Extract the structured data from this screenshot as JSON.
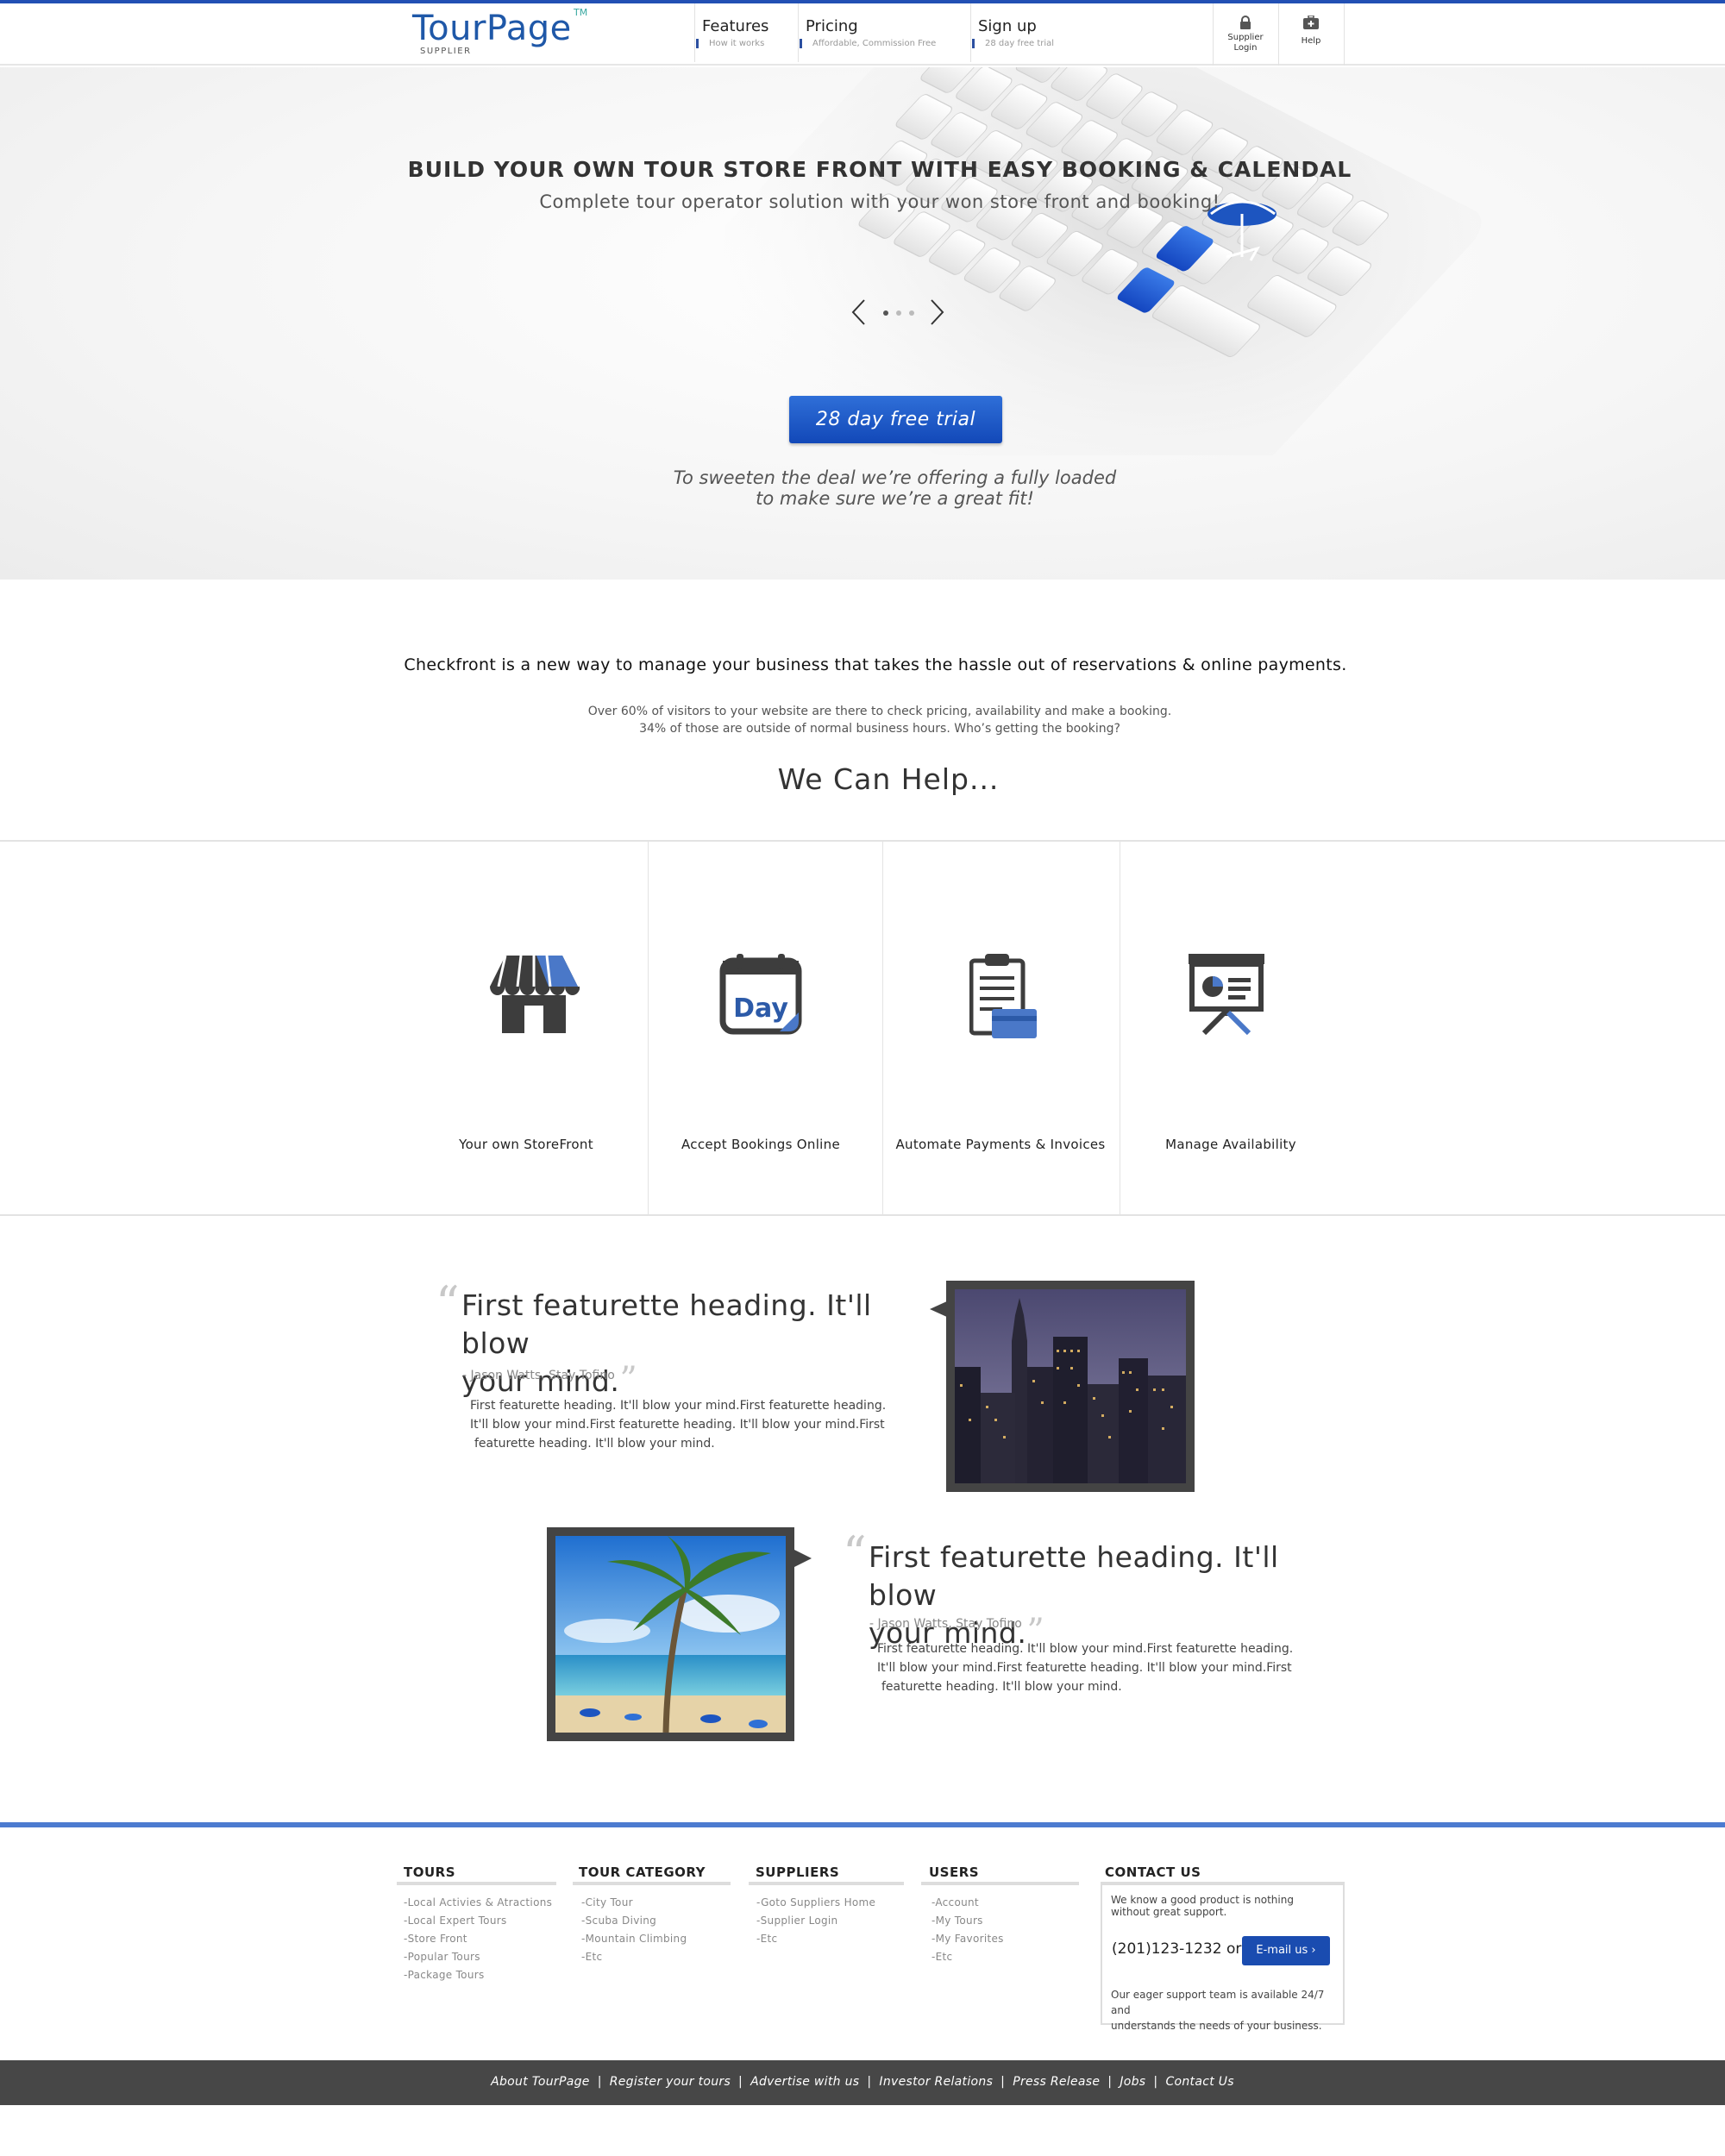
{
  "header": {
    "logo": "TourPage",
    "logo_tm": "TM",
    "logo_sub": "SUPPLIER",
    "nav": [
      {
        "title": "Features",
        "sub": "How it works"
      },
      {
        "title": "Pricing",
        "sub": "Affordable, Commission Free"
      },
      {
        "title": "Sign up",
        "sub": "28 day free trial"
      }
    ],
    "supplier_login": {
      "line1": "Supplier",
      "line2": "Login",
      "icon": "lock-icon"
    },
    "help": {
      "label": "Help",
      "icon": "first-aid-icon"
    }
  },
  "hero": {
    "title": "BUILD YOUR OWN TOUR STORE FRONT WITH EASY BOOKING & CALENDAL",
    "subtitle": "Complete tour operator solution with your won store front and booking!",
    "cta": "28 day free trial",
    "note_line1": "To sweeten the deal we’re offering a fully loaded",
    "note_line2": "to make sure we’re a great fit!"
  },
  "intro": {
    "lead": "Checkfront is a new way to manage your business that takes the hassle out of reservations & online payments.",
    "body_line1": "Over 60% of visitors to your website are there to check pricing, availability and make a booking.",
    "body_line2": "34% of those are outside of normal business hours. Who’s getting the booking?",
    "help_heading": "We Can Help..."
  },
  "features": [
    {
      "label": "Your own StoreFront",
      "icon": "storefront-icon"
    },
    {
      "label": "Accept Bookings Online",
      "icon": "calendar-day-icon",
      "icon_text": "Day"
    },
    {
      "label": "Automate Payments & Invoices",
      "icon": "clipboard-card-icon"
    },
    {
      "label": "Manage Availability",
      "icon": "presentation-board-icon"
    }
  ],
  "featurettes": [
    {
      "heading_line1": "First featurette heading. It'll blow",
      "heading_line2": "your mind.",
      "author": "- Jason Watts, Stay Tofino",
      "body_line1": "First featurette heading. It'll blow your mind.First featurette heading.",
      "body_line2": "It'll blow your mind.First featurette heading. It'll blow your mind.First",
      "body_line3": "featurette heading. It'll blow your mind.",
      "image": "city-skyline-night"
    },
    {
      "heading_line1": "First featurette heading. It'll blow",
      "heading_line2": "your mind.",
      "author": "- Jason Watts, Stay Tofino",
      "body_line1": "First featurette heading. It'll blow your mind.First featurette heading.",
      "body_line2": "It'll blow your mind.First featurette heading. It'll blow your mind.First",
      "body_line3": "featurette heading. It'll blow your mind.",
      "image": "palm-tree-beach"
    }
  ],
  "footer": {
    "tours": {
      "title": "TOURS",
      "links": [
        "-Local Activies & Atractions",
        "-Local Expert Tours",
        "-Store Front",
        "-Popular Tours",
        "-Package Tours"
      ]
    },
    "category": {
      "title": "TOUR CATEGORY",
      "links": [
        "-City Tour",
        "-Scuba Diving",
        "-Mountain Climbing",
        "-Etc"
      ]
    },
    "suppliers": {
      "title": "SUPPLIERS",
      "links": [
        "-Goto Suppliers Home",
        "-Supplier Login",
        "-Etc"
      ]
    },
    "users": {
      "title": "USERS",
      "links": [
        "-Account",
        "-My Tours",
        "-My Favorites",
        "-Etc"
      ]
    },
    "contact": {
      "title": "CONTACT US",
      "text": "We know a good product is nothing without great support.",
      "phone": "(201)123-1232  or",
      "email_btn": "E-mail us  ›",
      "support_line1": "Our eager support team is available 24/7 and",
      "support_line2": "understands the  needs of your business."
    },
    "bottom_links": [
      "About TourPage",
      "Register your tours",
      "Advertise with us",
      "Investor Relations",
      "Press Release",
      "Jobs",
      "Contact Us"
    ]
  },
  "colors": {
    "brand": "#1f58a8",
    "accent": "#2250b4",
    "button": "#1a4cb0",
    "footer_bar": "#474747"
  }
}
